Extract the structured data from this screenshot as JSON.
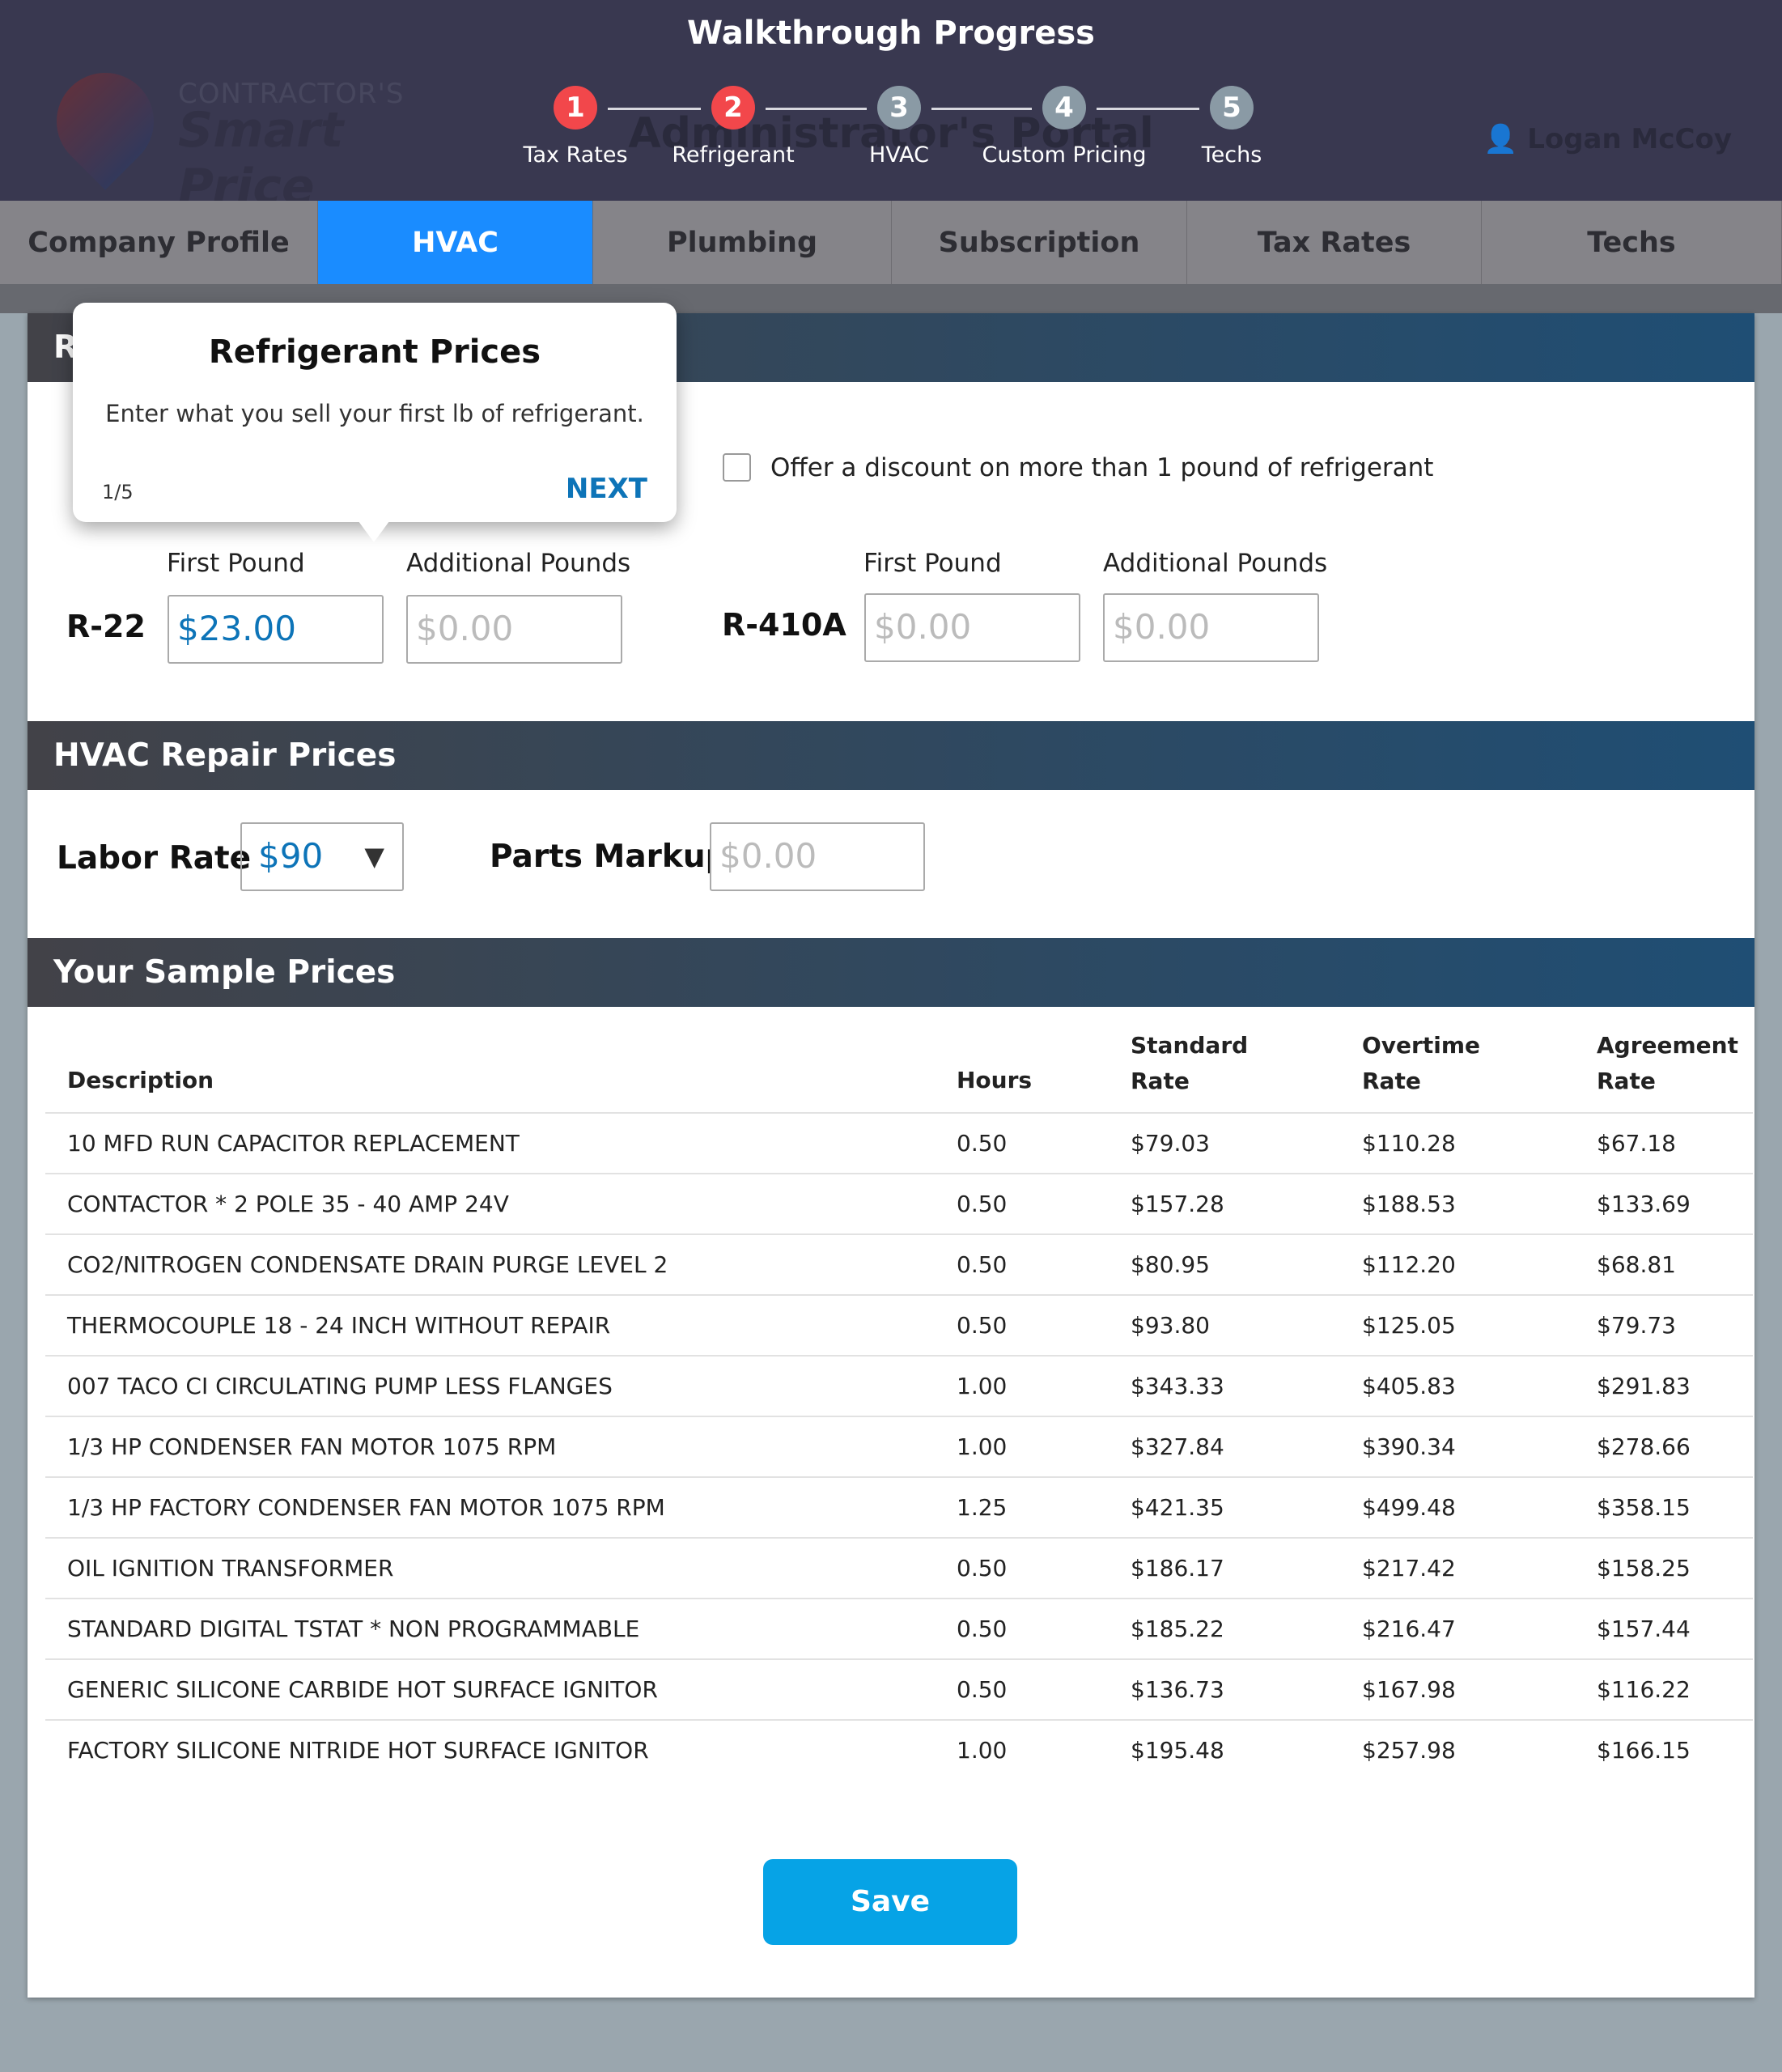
{
  "header": {
    "walkthrough_title": "Walkthrough Progress",
    "logo_line1": "CONTRACTOR'S",
    "logo_line2": "Smart Price",
    "portal_title": "Administrator's Portal",
    "user_name": "Logan McCoy",
    "steps": [
      {
        "n": "1",
        "label": "Tax Rates",
        "status": "done"
      },
      {
        "n": "2",
        "label": "Refrigerant",
        "status": "done"
      },
      {
        "n": "3",
        "label": "HVAC",
        "status": "todo"
      },
      {
        "n": "4",
        "label": "Custom Pricing",
        "status": "todo"
      },
      {
        "n": "5",
        "label": "Techs",
        "status": "todo"
      }
    ]
  },
  "tabs": [
    "Company Profile",
    "HVAC",
    "Plumbing",
    "Subscription",
    "Tax Rates",
    "Techs"
  ],
  "active_tab": "HVAC",
  "tooltip": {
    "title": "Refrigerant Prices",
    "body": "Enter what you sell your first lb of refrigerant.",
    "count": "1/5",
    "next": "NEXT"
  },
  "refrigerant": {
    "section_title_partial": "R",
    "discount_label": "Offer a discount on more than 1 pound of refrigerant",
    "discount_checked": false,
    "first_label": "First Pound",
    "additional_label": "Additional Pounds",
    "r22": {
      "name": "R-22",
      "first": "$23.00",
      "additional_placeholder": "$0.00"
    },
    "r410a": {
      "name": "R-410A",
      "first_placeholder": "$0.00",
      "additional_placeholder": "$0.00"
    }
  },
  "repair": {
    "title": "HVAC Repair Prices",
    "labor_label": "Labor Rate",
    "labor_value": "$90",
    "markup_label": "Parts Markup",
    "markup_placeholder": "$0.00"
  },
  "sample": {
    "title": "Your Sample Prices",
    "columns": {
      "desc": "Description",
      "hours": "Hours",
      "std1": "Standard",
      "std2": "Rate",
      "ot1": "Overtime",
      "ot2": "Rate",
      "ag1": "Agreement",
      "ag2": "Rate"
    },
    "rows": [
      [
        "10 MFD RUN CAPACITOR REPLACEMENT",
        "0.50",
        "$79.03",
        "$110.28",
        "$67.18"
      ],
      [
        "CONTACTOR * 2 POLE 35 - 40 AMP 24V",
        "0.50",
        "$157.28",
        "$188.53",
        "$133.69"
      ],
      [
        "CO2/NITROGEN CONDENSATE DRAIN PURGE LEVEL 2",
        "0.50",
        "$80.95",
        "$112.20",
        "$68.81"
      ],
      [
        "THERMOCOUPLE 18 - 24 INCH WITHOUT REPAIR",
        "0.50",
        "$93.80",
        "$125.05",
        "$79.73"
      ],
      [
        "007 TACO CI CIRCULATING PUMP LESS FLANGES",
        "1.00",
        "$343.33",
        "$405.83",
        "$291.83"
      ],
      [
        "1/3 HP CONDENSER FAN MOTOR 1075 RPM",
        "1.00",
        "$327.84",
        "$390.34",
        "$278.66"
      ],
      [
        "1/3 HP FACTORY CONDENSER FAN MOTOR 1075 RPM",
        "1.25",
        "$421.35",
        "$499.48",
        "$358.15"
      ],
      [
        "OIL IGNITION TRANSFORMER",
        "0.50",
        "$186.17",
        "$217.42",
        "$158.25"
      ],
      [
        "STANDARD DIGITAL TSTAT * NON PROGRAMMABLE",
        "0.50",
        "$185.22",
        "$216.47",
        "$157.44"
      ],
      [
        "GENERIC SILICONE CARBIDE HOT SURFACE IGNITOR",
        "0.50",
        "$136.73",
        "$167.98",
        "$116.22"
      ],
      [
        "FACTORY SILICONE NITRIDE HOT SURFACE IGNITOR",
        "1.00",
        "$195.48",
        "$257.98",
        "$166.15"
      ]
    ]
  },
  "save_label": "Save",
  "colors": {
    "header": "#393850",
    "active_tab": "#1a8cff",
    "step_done": "#f2474b",
    "step_todo": "#8a9aa5",
    "accent": "#0d74b8",
    "save": "#06a3e6"
  }
}
